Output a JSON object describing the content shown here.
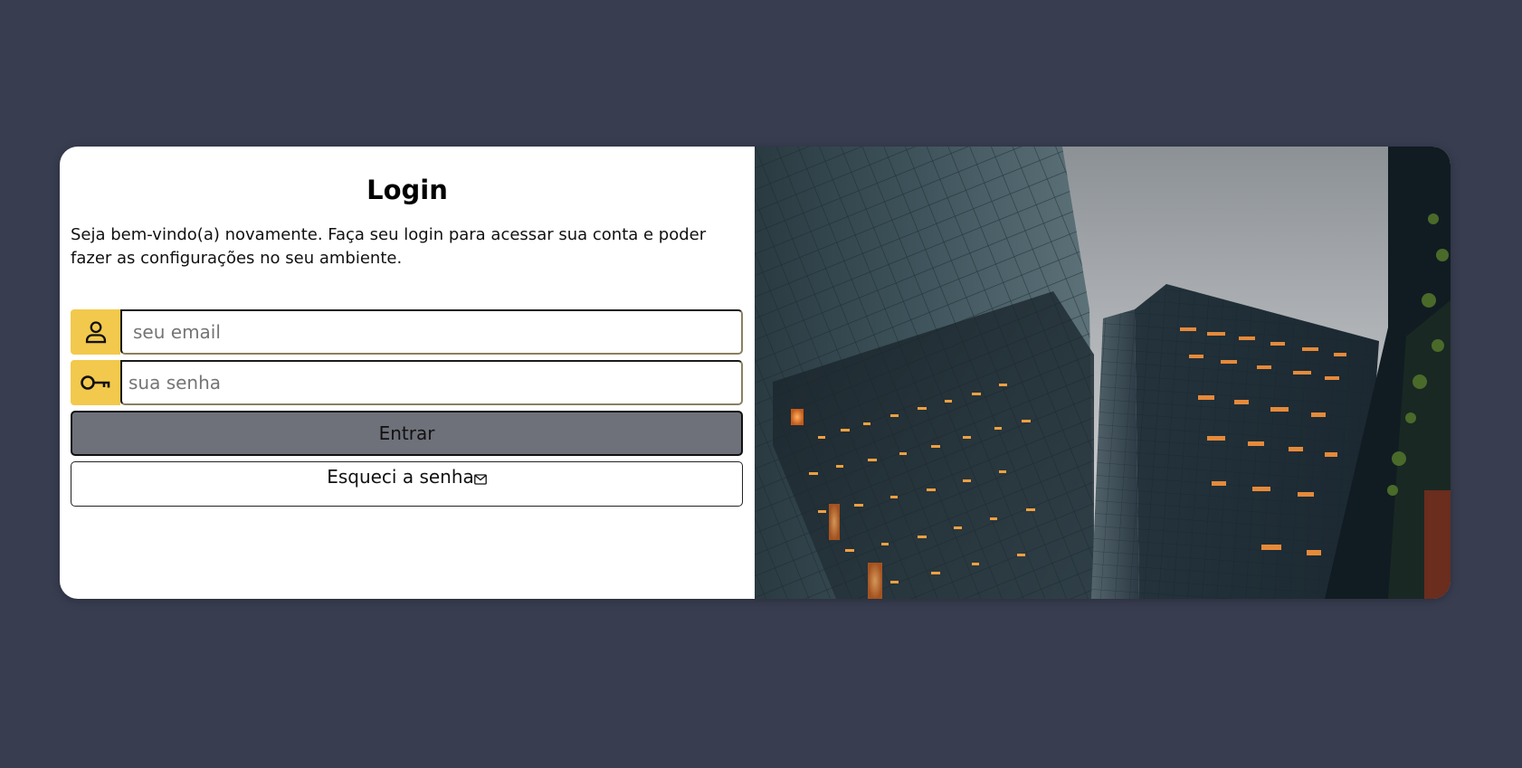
{
  "login": {
    "title": "Login",
    "welcome_text": "Seja bem-vindo(a) novamente. Faça seu login para acessar sua conta e poder fazer as configurações no seu ambiente.",
    "email_placeholder": "seu email",
    "password_placeholder": "sua senha",
    "submit_label": "Entrar",
    "forgot_label": "Esqueci a senha"
  },
  "icons": {
    "email_field": "user-icon",
    "password_field": "key-icon",
    "forgot_link": "mail-icon"
  },
  "colors": {
    "background": "#383d50",
    "card": "#ffffff",
    "accent": "#f2c94c",
    "primary_button": "#6e717a"
  }
}
